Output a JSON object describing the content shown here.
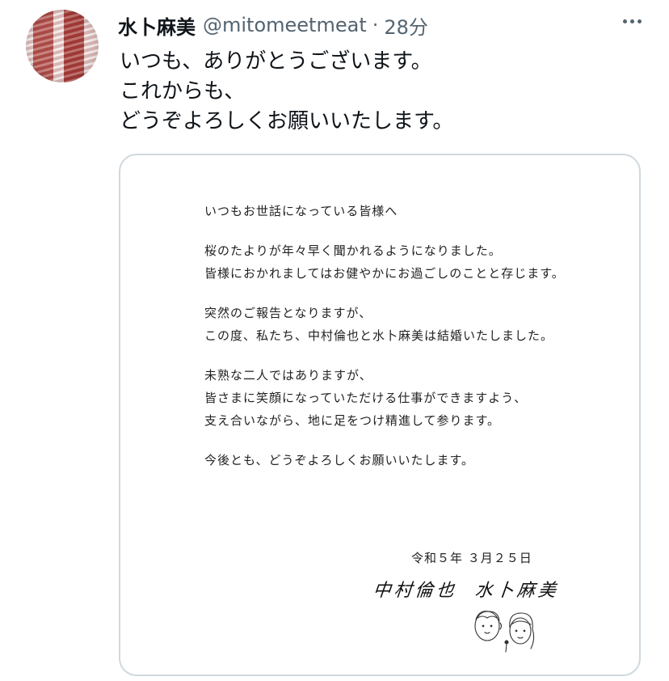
{
  "author": {
    "display_name": "水卜麻美",
    "handle": "@mitomeetmeat",
    "separator": "·",
    "time": "28分"
  },
  "tweet": {
    "lines": [
      "いつも、ありがとうございます。",
      "これからも、",
      "どうぞよろしくお願いいたします。"
    ]
  },
  "letter": {
    "greeting": "いつもお世話になっている皆様へ",
    "p1": [
      "桜のたよりが年々早く聞かれるようになりました。",
      "皆様におかれましてはお健やかにお過ごしのことと存じます。"
    ],
    "p2": [
      "突然のご報告となりますが、",
      "この度、私たち、中村倫也と水卜麻美は結婚いたしました。"
    ],
    "p3": [
      "未熟な二人ではありますが、",
      "皆さまに笑顔になっていただける仕事ができますよう、",
      "支え合いながら、地に足をつけ精進して参ります。"
    ],
    "closing": "今後とも、どうぞよろしくお願いいたします。",
    "date": "令和５年 ３月２５日",
    "signature_1": "中村倫也",
    "signature_2": "水卜麻美"
  }
}
